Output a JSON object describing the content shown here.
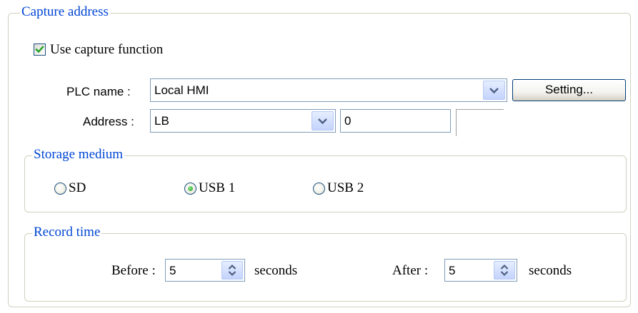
{
  "capture_group": {
    "title": "Capture address"
  },
  "use_capture": {
    "label": "Use capture function",
    "checked": true
  },
  "plc": {
    "label": "PLC name :",
    "value": "Local HMI",
    "setting_button": "Setting..."
  },
  "address": {
    "label": "Address :",
    "device": "LB",
    "value": "0",
    "extra": ""
  },
  "storage": {
    "title": "Storage medium",
    "options": [
      "SD",
      "USB 1",
      "USB 2"
    ],
    "selected": "USB 1"
  },
  "record": {
    "title": "Record time",
    "before_label": "Before :",
    "before_value": "5",
    "after_label": "After :",
    "after_value": "5",
    "unit": "seconds"
  },
  "icons": {
    "dropdown": "chevron-down-icon",
    "spinner": "up-down-arrows-icon",
    "check": "checkmark-icon"
  },
  "colors": {
    "group_title": "#0046d5",
    "checkmark": "#21a121",
    "frame_border": "#d0d0bf"
  }
}
